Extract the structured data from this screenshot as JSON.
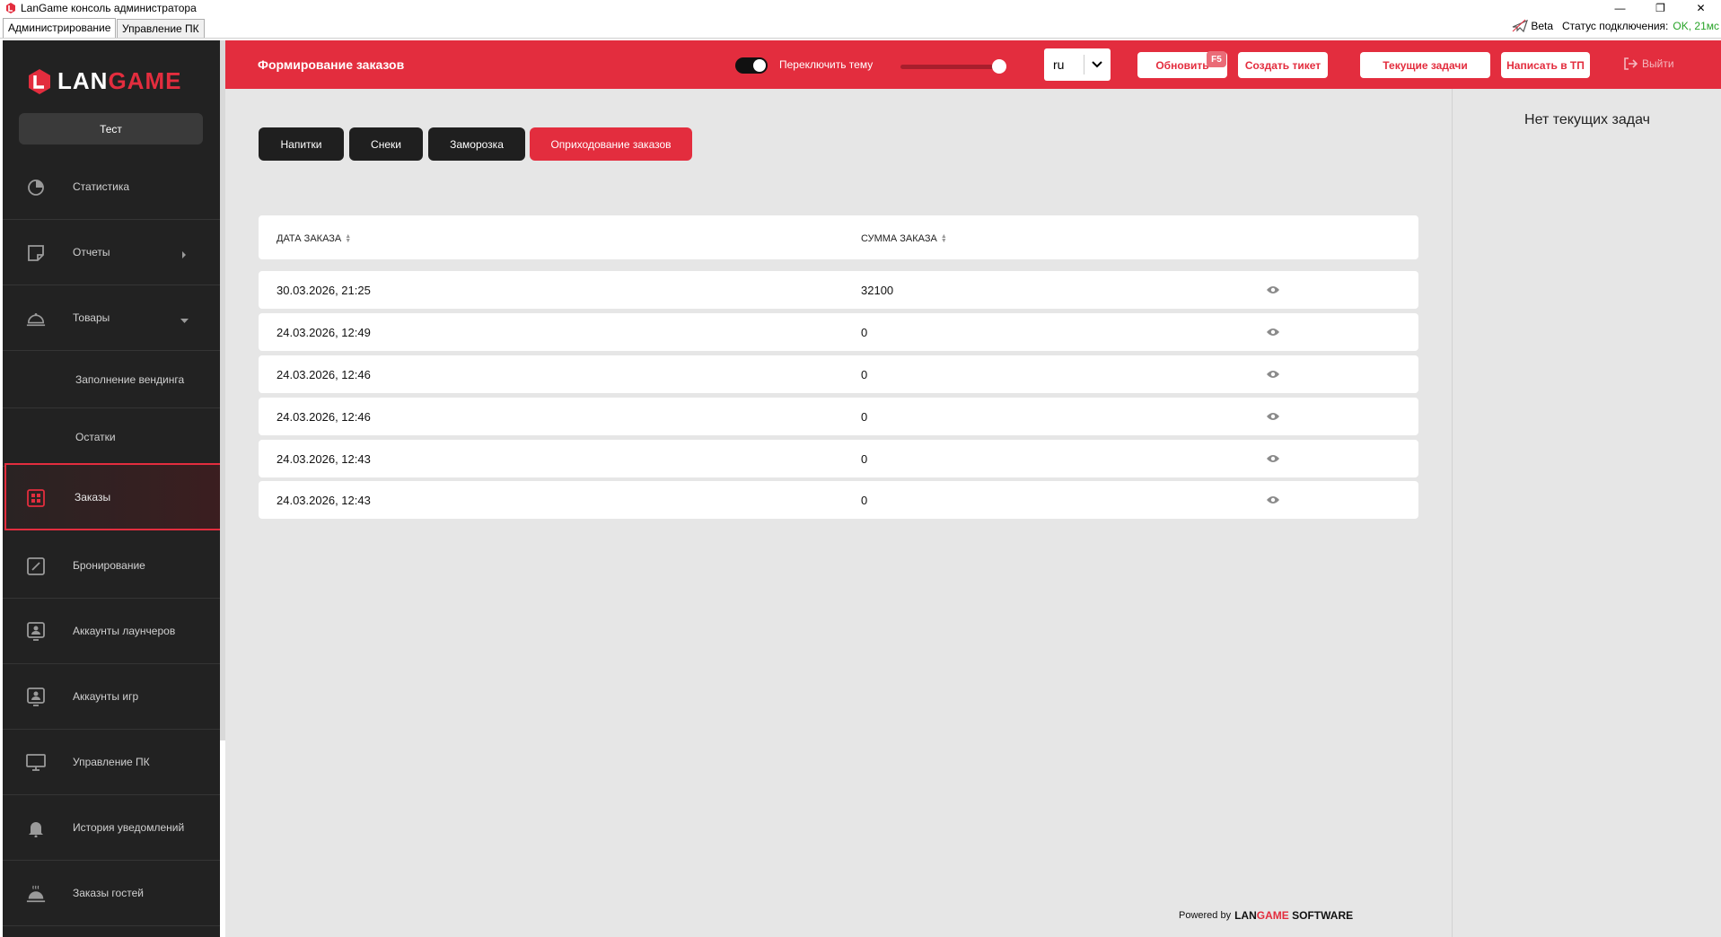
{
  "window": {
    "title": "LanGame консоль администратора",
    "tabs": [
      "Администрирование",
      "Управление ПК"
    ],
    "beta": "Beta",
    "connection_label": "Статус подключения:",
    "connection_value": "OK, 21мс"
  },
  "sidebar": {
    "logo_lan": "LAN",
    "logo_game": "GAME",
    "club": "Тест",
    "items": [
      {
        "label": "Статистика",
        "icon": "pie-chart-icon"
      },
      {
        "label": "Отчеты",
        "icon": "note-icon"
      },
      {
        "label": "Товары",
        "icon": "cloche-icon"
      },
      {
        "label": "Заполнение вендинга"
      },
      {
        "label": "Остатки"
      },
      {
        "label": "Заказы",
        "icon": "grid-icon"
      },
      {
        "label": "Бронирование",
        "icon": "edit-square-icon"
      },
      {
        "label": "Аккаунты лаунчеров",
        "icon": "account-icon"
      },
      {
        "label": "Аккаунты игр",
        "icon": "account-icon"
      },
      {
        "label": "Управление ПК",
        "icon": "monitor-icon"
      },
      {
        "label": "История уведомлений",
        "icon": "bell-icon"
      },
      {
        "label": "Заказы гостей",
        "icon": "cloche-steam-icon"
      }
    ]
  },
  "header": {
    "title": "Формирование заказов",
    "theme_label": "Переключить тему",
    "language": "ru",
    "refresh": "Обновить",
    "refresh_hotkey": "F5",
    "create_ticket": "Создать тикет",
    "current_tasks": "Текущие задачи",
    "write_support": "Написать в ТП",
    "logout": "Выйти"
  },
  "tabs": [
    "Напитки",
    "Снеки",
    "Заморозка",
    "Оприходование заказов"
  ],
  "table": {
    "columns": [
      "ДАТА ЗАКАЗА",
      "СУММА ЗАКАЗА"
    ],
    "rows": [
      {
        "date": "30.03.2026, 21:25",
        "sum": "32100"
      },
      {
        "date": "24.03.2026, 12:49",
        "sum": "0"
      },
      {
        "date": "24.03.2026, 12:46",
        "sum": "0"
      },
      {
        "date": "24.03.2026, 12:46",
        "sum": "0"
      },
      {
        "date": "24.03.2026, 12:43",
        "sum": "0"
      },
      {
        "date": "24.03.2026, 12:43",
        "sum": "0"
      }
    ]
  },
  "right_panel": {
    "empty_text": "Нет текущих задач"
  },
  "footer": {
    "powered_by": "Powered by",
    "brand_lan": "LAN",
    "brand_game": "GAME",
    "brand_software": "SOFTWARE"
  },
  "colors": {
    "accent": "#e32d3e",
    "sidebar": "#222222",
    "content_bg": "#e6e6e6"
  }
}
